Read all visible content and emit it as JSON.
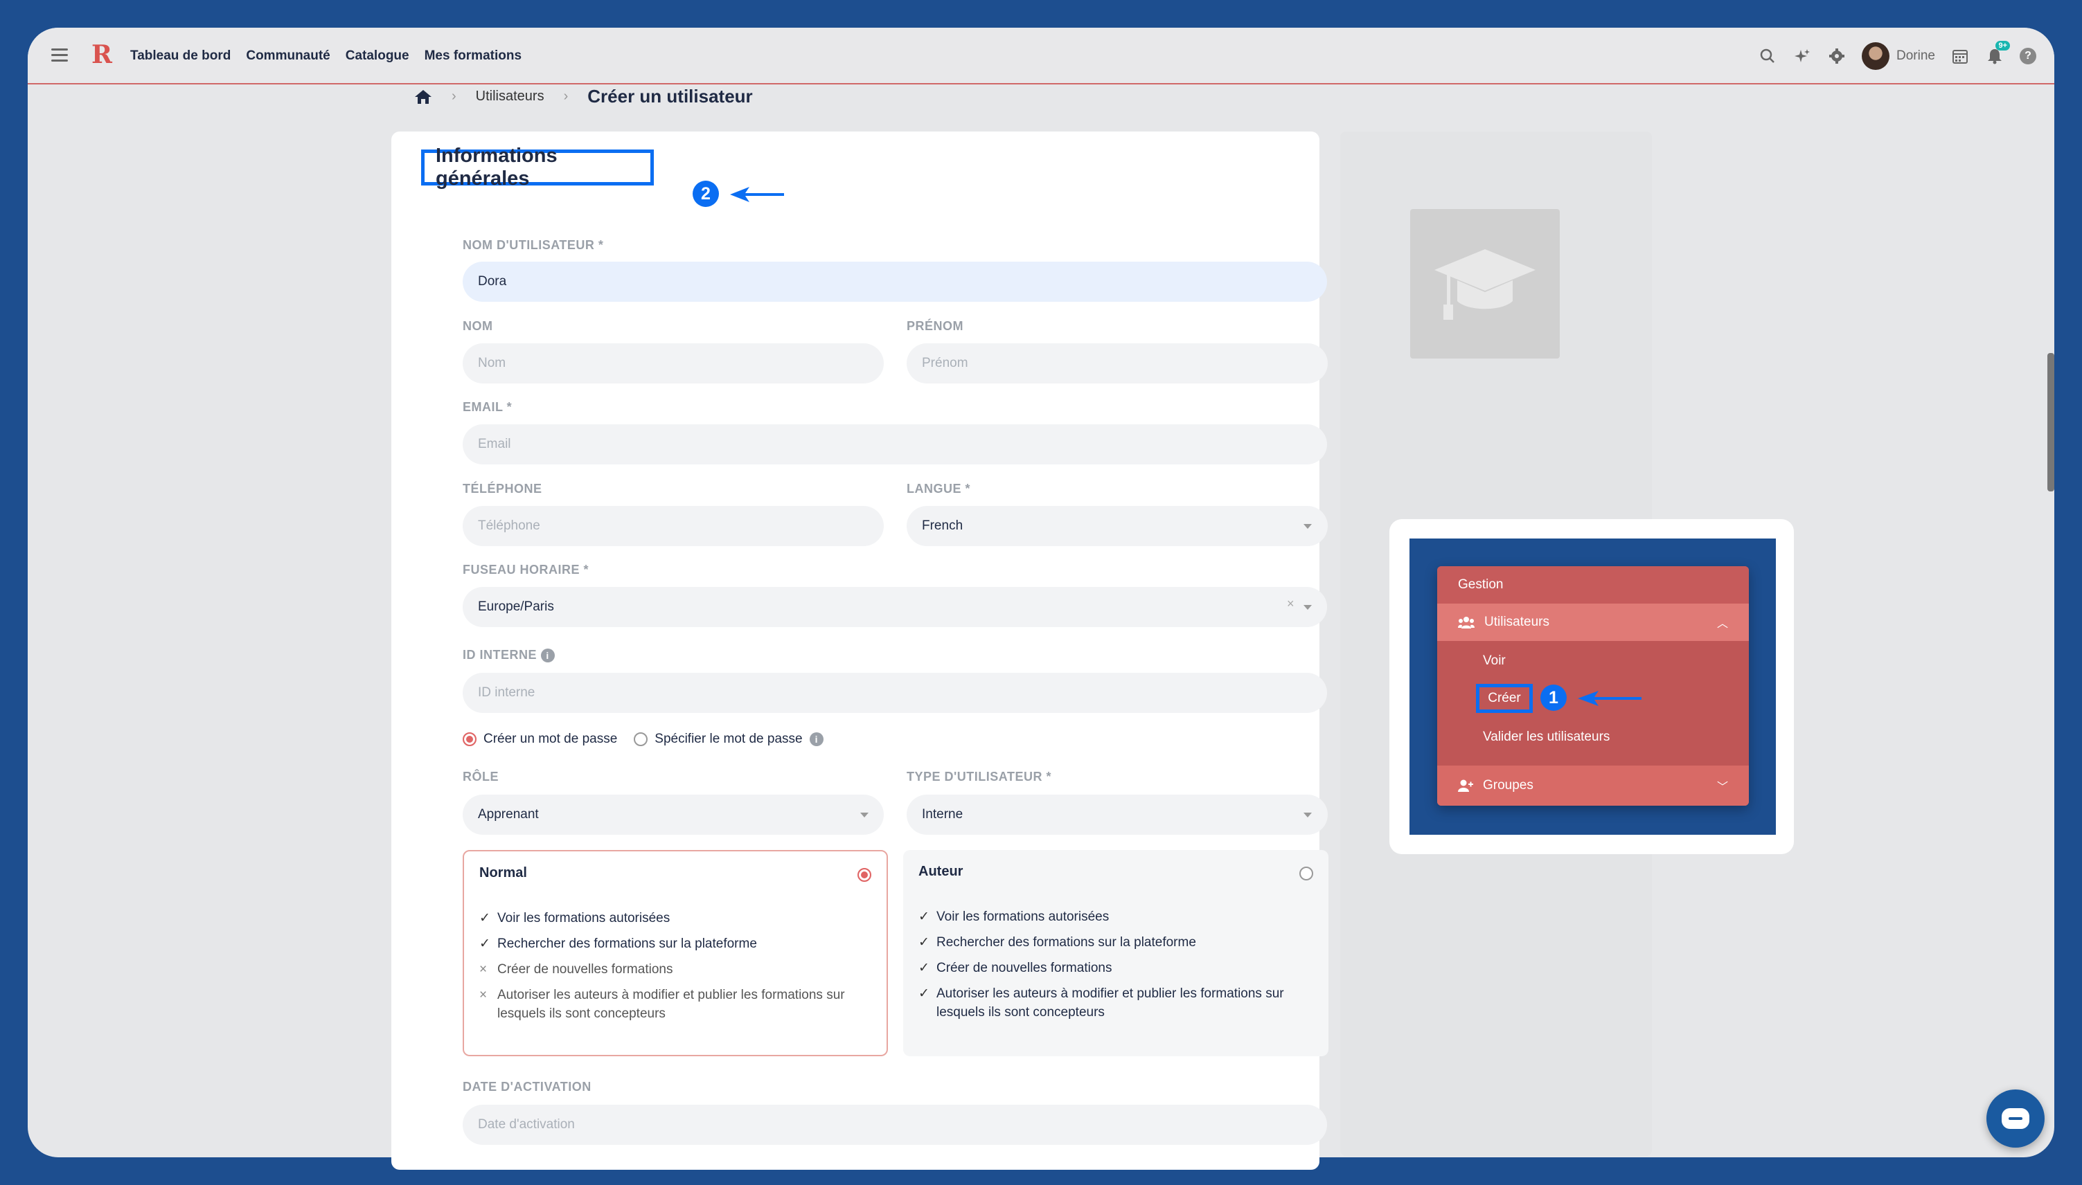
{
  "topbar": {
    "logo": "R",
    "nav": [
      "Tableau de bord",
      "Communauté",
      "Catalogue",
      "Mes formations"
    ],
    "user_name": "Dorine",
    "notif_badge": "9+",
    "icons": [
      "search-icon",
      "sparkle-icon",
      "gear-icon",
      "calendar-icon",
      "bell-icon",
      "help-icon"
    ]
  },
  "breadcrumb": {
    "home_icon": "home-icon",
    "parent": "Utilisateurs",
    "current": "Créer un utilisateur"
  },
  "form": {
    "section_title": "Informations générales",
    "step_badge": "2",
    "username_label": "NOM D'UTILISATEUR *",
    "username_value": "Dora",
    "nom_label": "NOM",
    "nom_placeholder": "Nom",
    "prenom_label": "PRÉNOM",
    "prenom_placeholder": "Prénom",
    "email_label": "EMAIL *",
    "email_placeholder": "Email",
    "phone_label": "TÉLÉPHONE",
    "phone_placeholder": "Téléphone",
    "lang_label": "LANGUE *",
    "lang_value": "French",
    "tz_label": "FUSEAU HORAIRE *",
    "tz_value": "Europe/Paris",
    "internal_id_label": "ID INTERNE",
    "internal_id_placeholder": "ID interne",
    "pw_option_create": "Créer un mot de passe",
    "pw_option_specify": "Spécifier le mot de passe",
    "role_label": "RÔLE",
    "role_value": "Apprenant",
    "user_type_label": "TYPE D'UTILISATEUR *",
    "user_type_value": "Interne",
    "activation_label": "DATE D'ACTIVATION",
    "activation_placeholder": "Date d'activation"
  },
  "roles": {
    "normal": {
      "title": "Normal",
      "perms": [
        {
          "text": "Voir les formations autorisées",
          "allowed": true
        },
        {
          "text": "Rechercher des formations sur la plateforme",
          "allowed": true
        },
        {
          "text": "Créer de nouvelles formations",
          "allowed": false
        },
        {
          "text": "Autoriser les auteurs à modifier et publier les formations sur lesquels ils sont concepteurs",
          "allowed": false
        }
      ]
    },
    "auteur": {
      "title": "Auteur",
      "perms": [
        {
          "text": "Voir les formations autorisées",
          "allowed": true
        },
        {
          "text": "Rechercher des formations sur la plateforme",
          "allowed": true
        },
        {
          "text": "Créer de nouvelles formations",
          "allowed": true
        },
        {
          "text": "Autoriser les auteurs à modifier et publier les formations sur lesquels ils sont concepteurs",
          "allowed": true
        }
      ]
    }
  },
  "mini_menu": {
    "header": "Gestion",
    "users": "Utilisateurs",
    "sub_items": [
      "Voir",
      "Créer",
      "Valider les utilisateurs"
    ],
    "groups": "Groupes",
    "step_badge": "1"
  },
  "colors": {
    "accent": "#0b6ef2",
    "brand": "#d9534f",
    "background": "#1d4e8f"
  }
}
